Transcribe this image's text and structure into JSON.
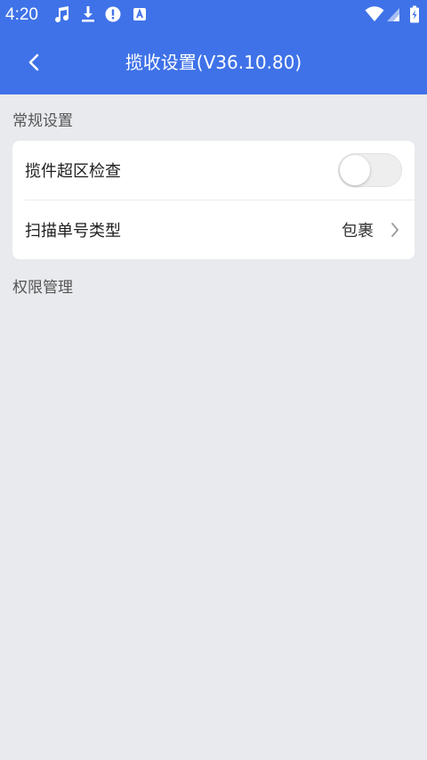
{
  "status_bar": {
    "time": "4:20"
  },
  "app_bar": {
    "title": "揽收设置(V36.10.80)"
  },
  "sections": [
    {
      "label": "常规设置",
      "items": [
        {
          "label": "揽件超区检查",
          "type": "toggle",
          "checked": false
        },
        {
          "label": "扫描单号类型",
          "type": "select",
          "value": "包裹"
        }
      ]
    },
    {
      "label": "权限管理",
      "items": []
    }
  ],
  "colors": {
    "header": "#3f72e8",
    "background": "#e9eaee",
    "card": "#ffffff"
  },
  "icons": {
    "status": [
      "music-note-icon",
      "download-icon",
      "alert-icon",
      "a-badge-icon",
      "wifi-icon",
      "signal-icon",
      "battery-icon"
    ],
    "back": "chevron-left-icon",
    "row_arrow": "chevron-right-icon"
  }
}
